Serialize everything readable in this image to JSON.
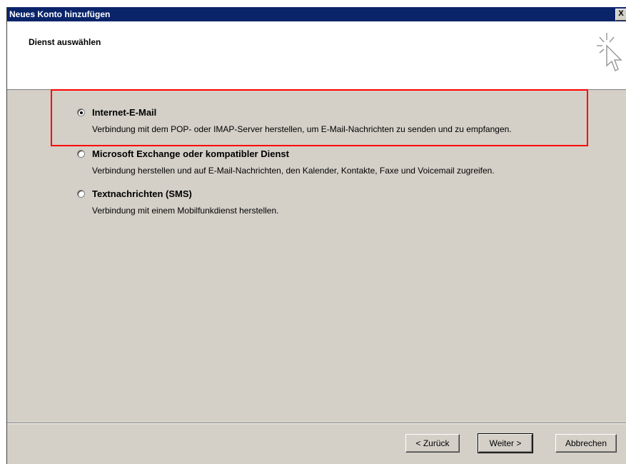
{
  "window": {
    "title": "Neues Konto hinzufügen",
    "close_label": "X"
  },
  "header": {
    "title": "Dienst auswählen"
  },
  "options": [
    {
      "label": "Internet-E-Mail",
      "description": "Verbindung mit dem POP- oder IMAP-Server herstellen, um E-Mail-Nachrichten zu senden und zu empfangen.",
      "selected": true
    },
    {
      "label": "Microsoft Exchange oder kompatibler Dienst",
      "description": "Verbindung herstellen und auf E-Mail-Nachrichten, den Kalender, Kontakte, Faxe und Voicemail zugreifen.",
      "selected": false
    },
    {
      "label": "Textnachrichten (SMS)",
      "description": "Verbindung mit einem Mobilfunkdienst herstellen.",
      "selected": false
    }
  ],
  "buttons": {
    "back": "< Zurück",
    "next": "Weiter >",
    "cancel": "Abbrechen"
  },
  "colors": {
    "titlebar": "#0a246a",
    "highlight": "#ff0000",
    "dialog_bg": "#d4d0c8"
  }
}
